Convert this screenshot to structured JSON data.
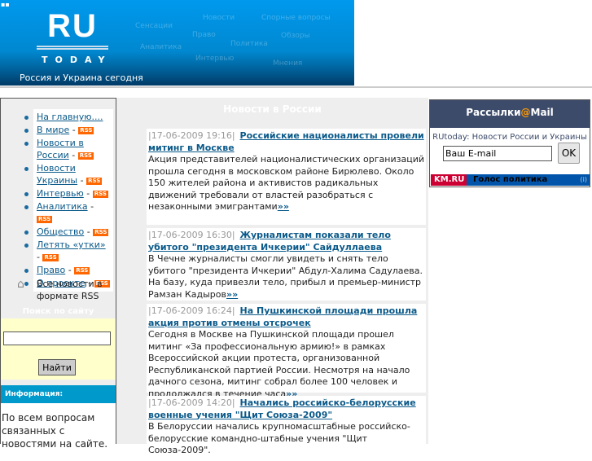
{
  "header": {
    "logo_top": "RU",
    "logo_bottom": "TODAY",
    "tagline": "Россия и Украина сегодня",
    "cloud": [
      "Сенсации",
      "Новости",
      "Спорные вопросы",
      "Право",
      "Обзоры",
      "Политика",
      "Аналитика",
      "Интервью",
      "Мнения"
    ]
  },
  "sidebar": {
    "items": [
      {
        "label": "На главную....",
        "rss": false
      },
      {
        "label": "В мире",
        "rss": true
      },
      {
        "label": "Новости в России",
        "rss": true
      },
      {
        "label": "Новости Украины",
        "rss": true
      },
      {
        "label": "Интервью",
        "rss": true
      },
      {
        "label": "Аналитика",
        "rss": true
      },
      {
        "label": "Общество",
        "rss": true
      },
      {
        "label": "Летять «утки»",
        "rss": true
      },
      {
        "label": "Право",
        "rss": true
      },
      {
        "label": "О проекте",
        "rss": true
      }
    ],
    "rss_badge": "RSS",
    "all_rss": "Все новости в формате RSS",
    "search_title": "Поиск по сайту",
    "search_value": "",
    "search_button": "Найти",
    "info_title": "Информация:",
    "info_text": "По всем вопросам связанных с новостями на сайте."
  },
  "main": {
    "title": "Новости в России",
    "more": "»»",
    "news": [
      {
        "date": "|17-06-2009 19:16|",
        "title": "Российские националисты провели митинг в Москве",
        "text": "Акция представителей националистических организаций прошла сегодня в московском районе Бирюлево. Около 150 жителей района и активистов радикальных движений требовали от властей разобраться с незаконными эмигрантами"
      },
      {
        "date": "|17-06-2009 16:30|",
        "title": "Журналистам показали тело убитого \"президента Ичкерии\" Сайдуллаева",
        "text": "В Чечне журналисты смогли увидеть и снять тело убитого \"президента Ичкерии\" Абдул-Халима Садулаева. На базу, куда привезли тело, прибыл и премьер-министр Рамзан Кадыров"
      },
      {
        "date": "|17-06-2009 16:24|",
        "title": "На Пушкинской площади прошла акция против отмены отсрочек",
        "text": "Сегодня в Москве на Пушкинской площади прошел митинг «За профессиональную армию!» в рамках Всероссийской акции протеста, организованной Республиканской партией России. Несмотря на начало дачного сезона, митинг собрал более 100 человек и продолжался в течение часа"
      },
      {
        "date": "|17-06-2009 14:20|",
        "title": "Начались российско-белорусские военные учения \"Щит Союза-2009\"",
        "text": "В Белоруссии начались крупномасштабные российско-белорусские командно-штабные учения \"Щит Союза-2009\"."
      }
    ]
  },
  "mail": {
    "title_a": "Рассылки",
    "title_at": "@",
    "title_b": "Mail",
    "subtitle": "RUtoday: Новости России и Украины",
    "email_value": "Ваш E-mail",
    "ok": "OK"
  },
  "km": {
    "logo": "KM.RU",
    "title": "Голос политика",
    "info": "(i)"
  }
}
